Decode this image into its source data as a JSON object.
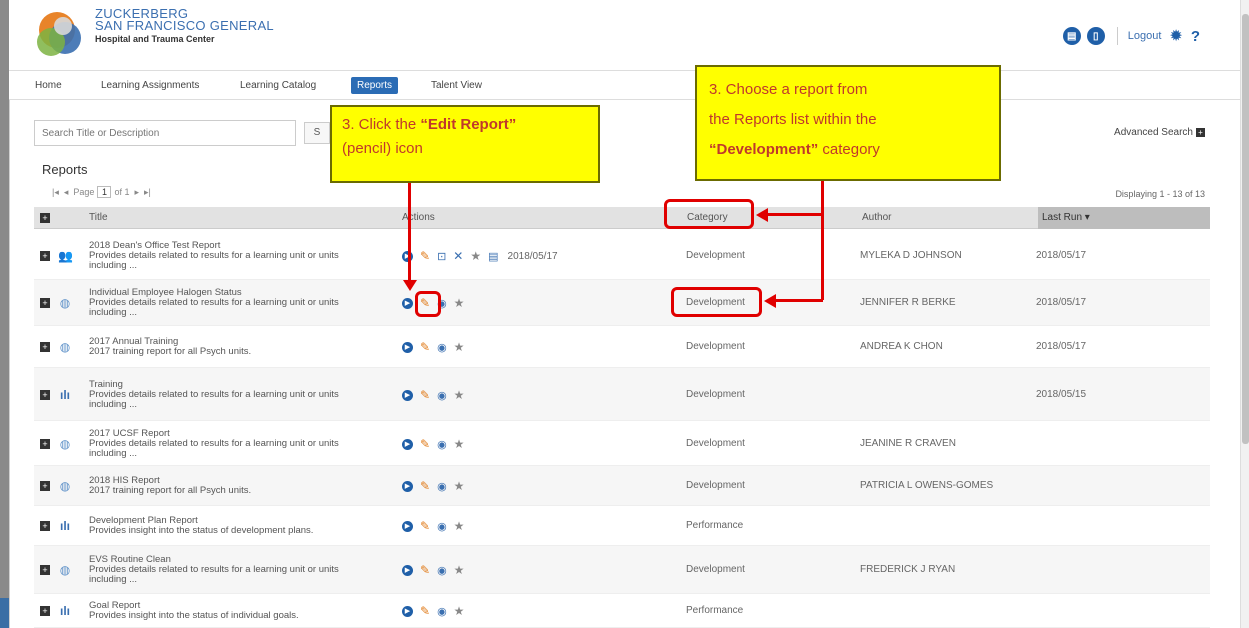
{
  "header": {
    "brand_line1": "ZUCKERBERG",
    "brand_line2": "SAN FRANCISCO GENERAL",
    "brand_line3": "Hospital and Trauma Center",
    "logout_label": "Logout",
    "help_label": "?"
  },
  "nav": {
    "items": [
      {
        "label": "Home"
      },
      {
        "label": "Learning Assignments"
      },
      {
        "label": "Learning Catalog"
      },
      {
        "label": "Reports"
      },
      {
        "label": "Talent View"
      }
    ],
    "active": "Reports"
  },
  "search": {
    "placeholder": "Search Title or Description",
    "button_label": "S",
    "advanced_label": "Advanced Search"
  },
  "reports": {
    "title": "Reports",
    "pager": {
      "page_label": "Page",
      "page_value": "1",
      "of_label": "of 1"
    },
    "displaying": "Displaying 1 - 13 of 13",
    "columns": {
      "title": "Title",
      "actions": "Actions",
      "category": "Category",
      "author": "Author",
      "last_run": "Last Run ▾"
    },
    "rows": [
      {
        "title": "2018 Dean's Office Test Report",
        "desc1": "Provides details related to results for a learning unit or units",
        "desc2": "including ...",
        "category": "Development",
        "author": "MYLEKA D JOHNSON",
        "last_run": "2018/05/17",
        "action_date": "2018/05/17",
        "icon": "people-icon"
      },
      {
        "title": "Individual Employee Halogen Status",
        "desc1": "Provides details related to results for a learning unit or units",
        "desc2": "including ...",
        "category": "Development",
        "author": "JENNIFER R BERKE",
        "last_run": "2018/05/17",
        "icon": "globe-icon"
      },
      {
        "title": "2017 Annual Training",
        "desc1": "2017 training report for all Psych units.",
        "desc2": "",
        "category": "Development",
        "author": "ANDREA K CHON",
        "last_run": "2018/05/17",
        "icon": "globe-icon"
      },
      {
        "title": "Training",
        "desc1": "Provides details related to results for a learning unit or units",
        "desc2": "including ...",
        "category": "Development",
        "author": "",
        "last_run": "2018/05/15",
        "icon": "bar-chart-icon"
      },
      {
        "title": "2017 UCSF Report",
        "desc1": "Provides details related to results for a learning unit or units",
        "desc2": "including ...",
        "category": "Development",
        "author": "JEANINE R CRAVEN",
        "last_run": "",
        "icon": "globe-icon"
      },
      {
        "title": "2018 HIS Report",
        "desc1": "2017 training report for all Psych units.",
        "desc2": "",
        "category": "Development",
        "author": "PATRICIA L OWENS-GOMES",
        "last_run": "",
        "icon": "globe-icon"
      },
      {
        "title": "Development Plan Report",
        "desc1": "Provides insight into the status of development plans.",
        "desc2": "",
        "category": "Performance",
        "author": "",
        "last_run": "",
        "icon": "bar-chart-icon"
      },
      {
        "title": "EVS Routine Clean",
        "desc1": "Provides details related to results for a learning unit or units",
        "desc2": "including ...",
        "category": "Development",
        "author": "FREDERICK J RYAN",
        "last_run": "",
        "icon": "globe-icon"
      },
      {
        "title": "Goal Report",
        "desc1": "Provides insight into the status of individual goals.",
        "desc2": "",
        "category": "Performance",
        "author": "",
        "last_run": "",
        "icon": "bar-chart-icon"
      }
    ]
  },
  "annotations": {
    "edit_callout_prefix": "3. Click the ",
    "edit_callout_bold": "“Edit Report”",
    "edit_callout_suffix": " (pencil) icon",
    "choose_callout_line1": "3. Choose a report from",
    "choose_callout_line2": "the Reports list within the",
    "choose_callout_bold": "“Development”",
    "choose_callout_suffix": " category"
  },
  "colors": {
    "brand_blue": "#3b6fb0",
    "callout_yellow": "#ffff00",
    "highlight_red": "#e00000",
    "pencil_orange": "#e07b1a"
  }
}
